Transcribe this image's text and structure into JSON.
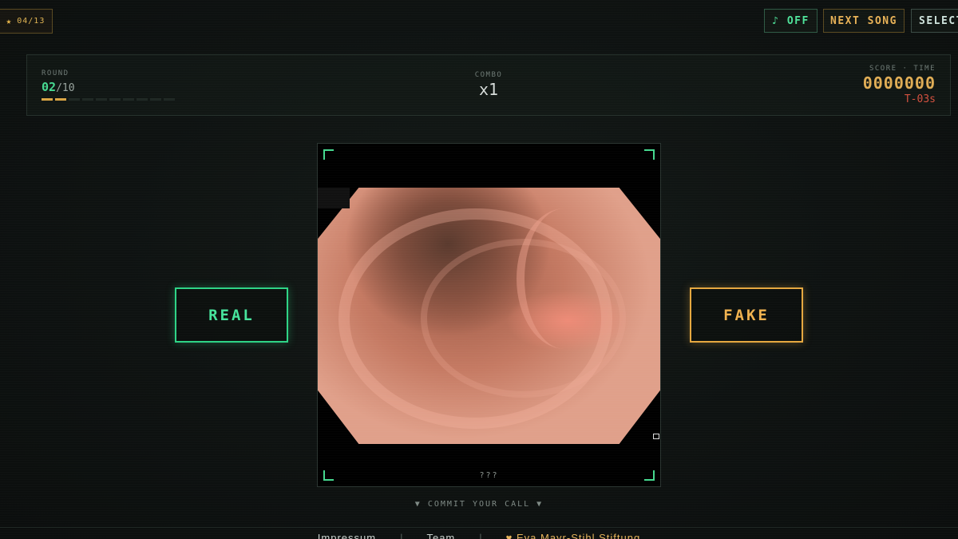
{
  "badge": {
    "icon": "star-icon",
    "text": "04/13"
  },
  "top_buttons": {
    "music": "♪ OFF",
    "next_song": "NEXT SONG",
    "select": "SELECT"
  },
  "hud": {
    "round_label": "ROUND",
    "round_current": "02",
    "round_total": "/10",
    "rounds_completed": 2,
    "rounds_total": 10,
    "combo_label": "COMBO",
    "combo_value": "x1",
    "score_label": "SCORE · TIME",
    "score_value": "0000000",
    "time_value": "T-03s"
  },
  "viewer": {
    "caption": "???"
  },
  "choices": {
    "real": "REAL",
    "fake": "FAKE"
  },
  "prompt": "▼ COMMIT YOUR CALL ▼",
  "footer": {
    "impressum": "Impressum",
    "sep": "|",
    "team": "Team",
    "sponsor": "♥ Eva Mayr-Stihl Stiftung"
  },
  "colors": {
    "accent_green": "#46e39c",
    "accent_amber": "#f0b24f",
    "alert_red": "#d2503f",
    "background": "#0e1211"
  }
}
